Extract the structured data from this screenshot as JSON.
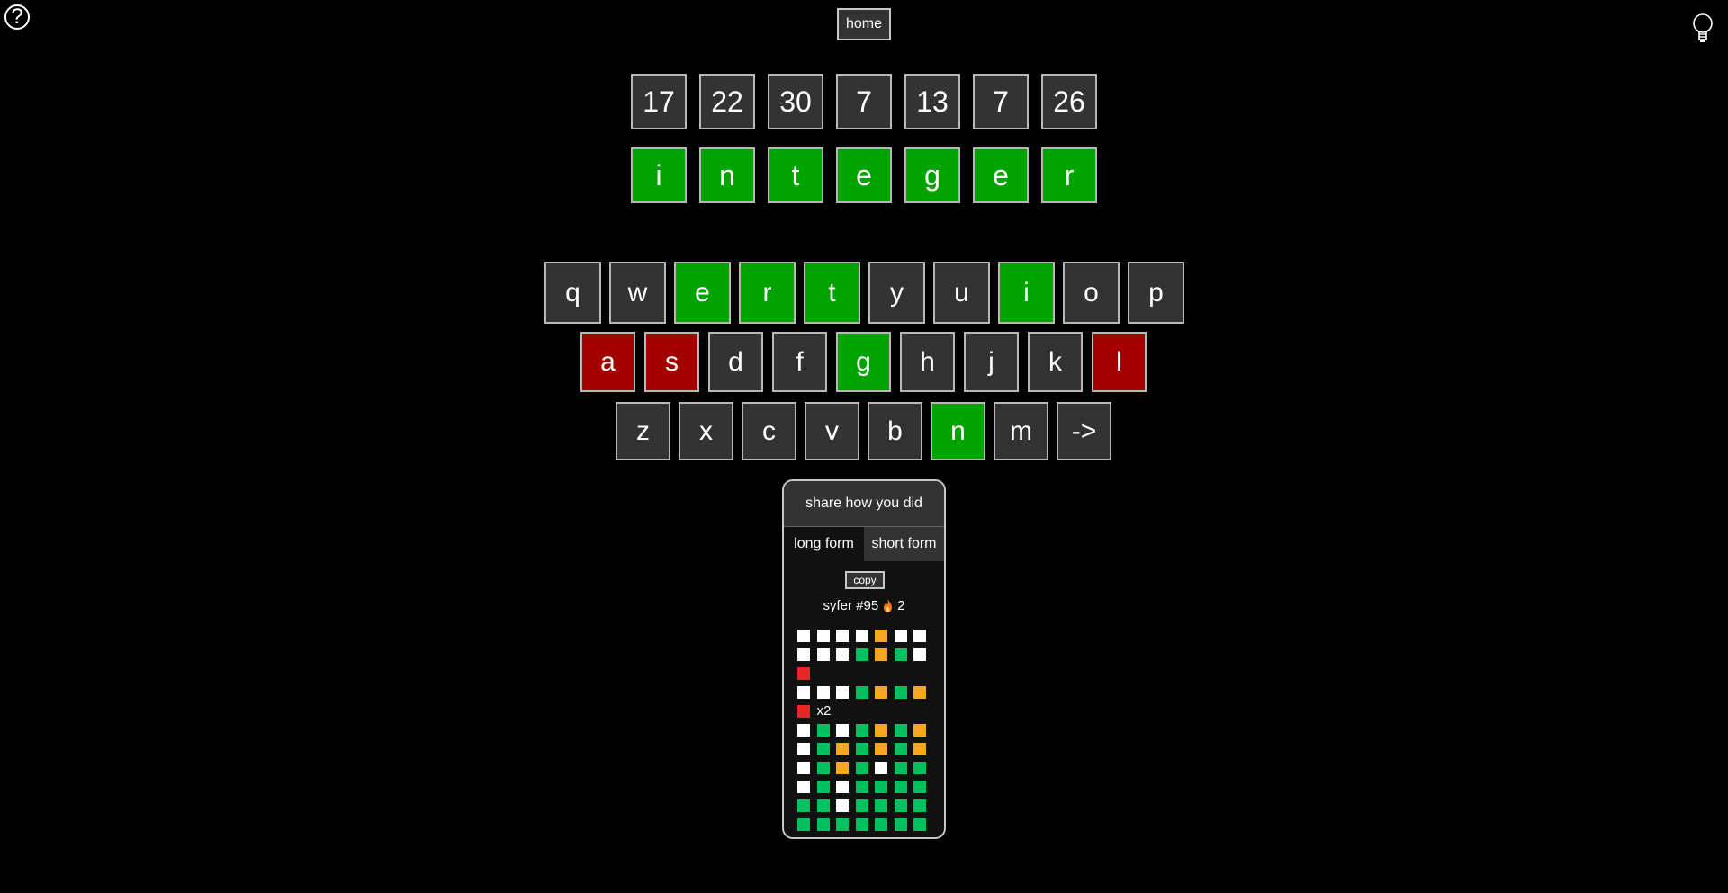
{
  "header": {
    "home_label": "home",
    "help_icon": "question-circle-icon",
    "help_glyph": "?",
    "hint_icon": "lightbulb-icon"
  },
  "puzzle": {
    "numbers": [
      "17",
      "22",
      "30",
      "7",
      "13",
      "7",
      "26"
    ],
    "answer": [
      "i",
      "n",
      "t",
      "e",
      "g",
      "e",
      "r"
    ],
    "answer_status": [
      "correct",
      "correct",
      "correct",
      "correct",
      "correct",
      "correct",
      "correct"
    ]
  },
  "keyboard": {
    "rows": [
      [
        {
          "label": "q",
          "state": "unused"
        },
        {
          "label": "w",
          "state": "unused"
        },
        {
          "label": "e",
          "state": "correct"
        },
        {
          "label": "r",
          "state": "correct"
        },
        {
          "label": "t",
          "state": "correct"
        },
        {
          "label": "y",
          "state": "unused"
        },
        {
          "label": "u",
          "state": "unused"
        },
        {
          "label": "i",
          "state": "correct"
        },
        {
          "label": "o",
          "state": "unused"
        },
        {
          "label": "p",
          "state": "unused"
        }
      ],
      [
        {
          "label": "a",
          "state": "wrong"
        },
        {
          "label": "s",
          "state": "wrong"
        },
        {
          "label": "d",
          "state": "unused"
        },
        {
          "label": "f",
          "state": "unused"
        },
        {
          "label": "g",
          "state": "correct"
        },
        {
          "label": "h",
          "state": "unused"
        },
        {
          "label": "j",
          "state": "unused"
        },
        {
          "label": "k",
          "state": "unused"
        },
        {
          "label": "l",
          "state": "wrong"
        }
      ],
      [
        {
          "label": "z",
          "state": "unused"
        },
        {
          "label": "x",
          "state": "unused"
        },
        {
          "label": "c",
          "state": "unused"
        },
        {
          "label": "v",
          "state": "unused"
        },
        {
          "label": "b",
          "state": "unused"
        },
        {
          "label": "n",
          "state": "correct"
        },
        {
          "label": "m",
          "state": "unused"
        },
        {
          "label": "->",
          "state": "unused"
        }
      ]
    ],
    "colors": {
      "correct": "#00a300",
      "wrong": "#a30000",
      "unused": "#333333"
    }
  },
  "share": {
    "title": "share how you did",
    "tabs": [
      {
        "label": "long form",
        "active": true
      },
      {
        "label": "short form",
        "active": false
      }
    ],
    "copy_label": "copy",
    "game_label": "syfer #95",
    "streak_icon": "flame-icon",
    "streak": "2",
    "grid_colors": {
      "w": "#ffffff",
      "g": "#00c060",
      "o": "#f5a623",
      "r": "#e82626"
    },
    "grid": [
      {
        "cells": [
          "w",
          "w",
          "w",
          "w",
          "o",
          "w",
          "w"
        ]
      },
      {
        "cells": [
          "w",
          "w",
          "w",
          "g",
          "o",
          "g",
          "w"
        ]
      },
      {
        "cells": [
          "r"
        ]
      },
      {
        "cells": [
          "w",
          "w",
          "w",
          "g",
          "o",
          "g",
          "o"
        ]
      },
      {
        "cells": [
          "r"
        ],
        "suffix": "x2"
      },
      {
        "cells": [
          "w",
          "g",
          "w",
          "g",
          "o",
          "g",
          "o"
        ]
      },
      {
        "cells": [
          "w",
          "g",
          "o",
          "g",
          "o",
          "g",
          "o"
        ]
      },
      {
        "cells": [
          "w",
          "g",
          "o",
          "g",
          "w",
          "g",
          "g"
        ]
      },
      {
        "cells": [
          "w",
          "g",
          "w",
          "g",
          "g",
          "g",
          "g"
        ]
      },
      {
        "cells": [
          "g",
          "g",
          "w",
          "g",
          "g",
          "g",
          "g"
        ]
      },
      {
        "cells": [
          "g",
          "g",
          "g",
          "g",
          "g",
          "g",
          "g"
        ]
      }
    ]
  }
}
